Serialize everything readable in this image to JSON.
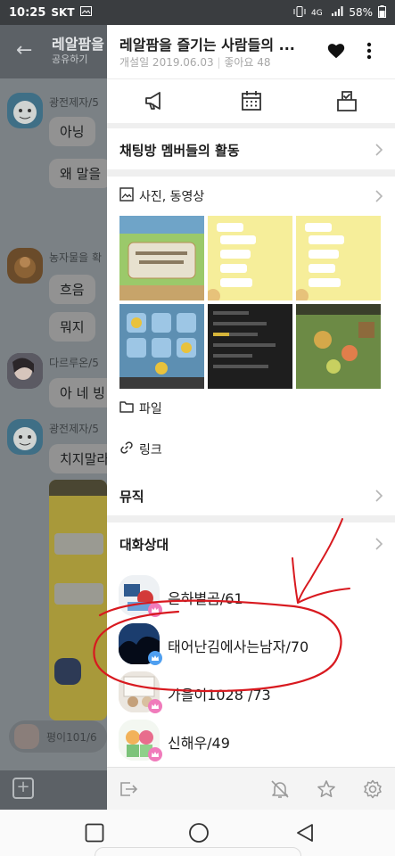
{
  "status_bar": {
    "time": "10:25",
    "carrier": "SKT",
    "battery": "58%"
  },
  "background_chat": {
    "title": "레알팜을",
    "subtitle": "공유하기",
    "messages": [
      {
        "sender": "광전제자/5",
        "text": "아닝"
      },
      {
        "sender": "",
        "text": "왜 말을"
      },
      {
        "sender": "농자물을 확",
        "text": "흐음"
      },
      {
        "sender": "",
        "text": "뭐지"
      },
      {
        "sender": "다르루온/5",
        "text": "아 네 빙"
      },
      {
        "sender": "광전제자/5",
        "text": "치지말라"
      }
    ],
    "input_preview": "평이101/6"
  },
  "drawer": {
    "title": "레알팜을 즐기는 사람들의 ...",
    "created_label": "개설일 2019.06.03",
    "likes_label": "좋아요 48",
    "toolbar_icons": [
      "megaphone-icon",
      "calendar-icon",
      "vote-icon"
    ],
    "activity_title": "채팅방 멤버들의 활동",
    "media": {
      "label": "사진, 동영상",
      "thumbnail_count": 6
    },
    "files_label": "파일",
    "links_label": "링크",
    "music_title": "뮤직",
    "members_title": "대화상대",
    "members": [
      {
        "name": "은하별곰/61",
        "crown": "pink"
      },
      {
        "name": "태어난김에사는남자/70",
        "crown": "blue"
      },
      {
        "name": "가을이1028 /73",
        "crown": "pink"
      },
      {
        "name": "신해우/49",
        "crown": "pink"
      }
    ],
    "footer_icons": [
      "exit-icon",
      "notifications-off-icon",
      "star-icon",
      "settings-icon"
    ]
  },
  "colors": {
    "annotation_red": "#d8191f",
    "crown_pink": "#f07bbb",
    "crown_blue": "#4f9ff0"
  }
}
